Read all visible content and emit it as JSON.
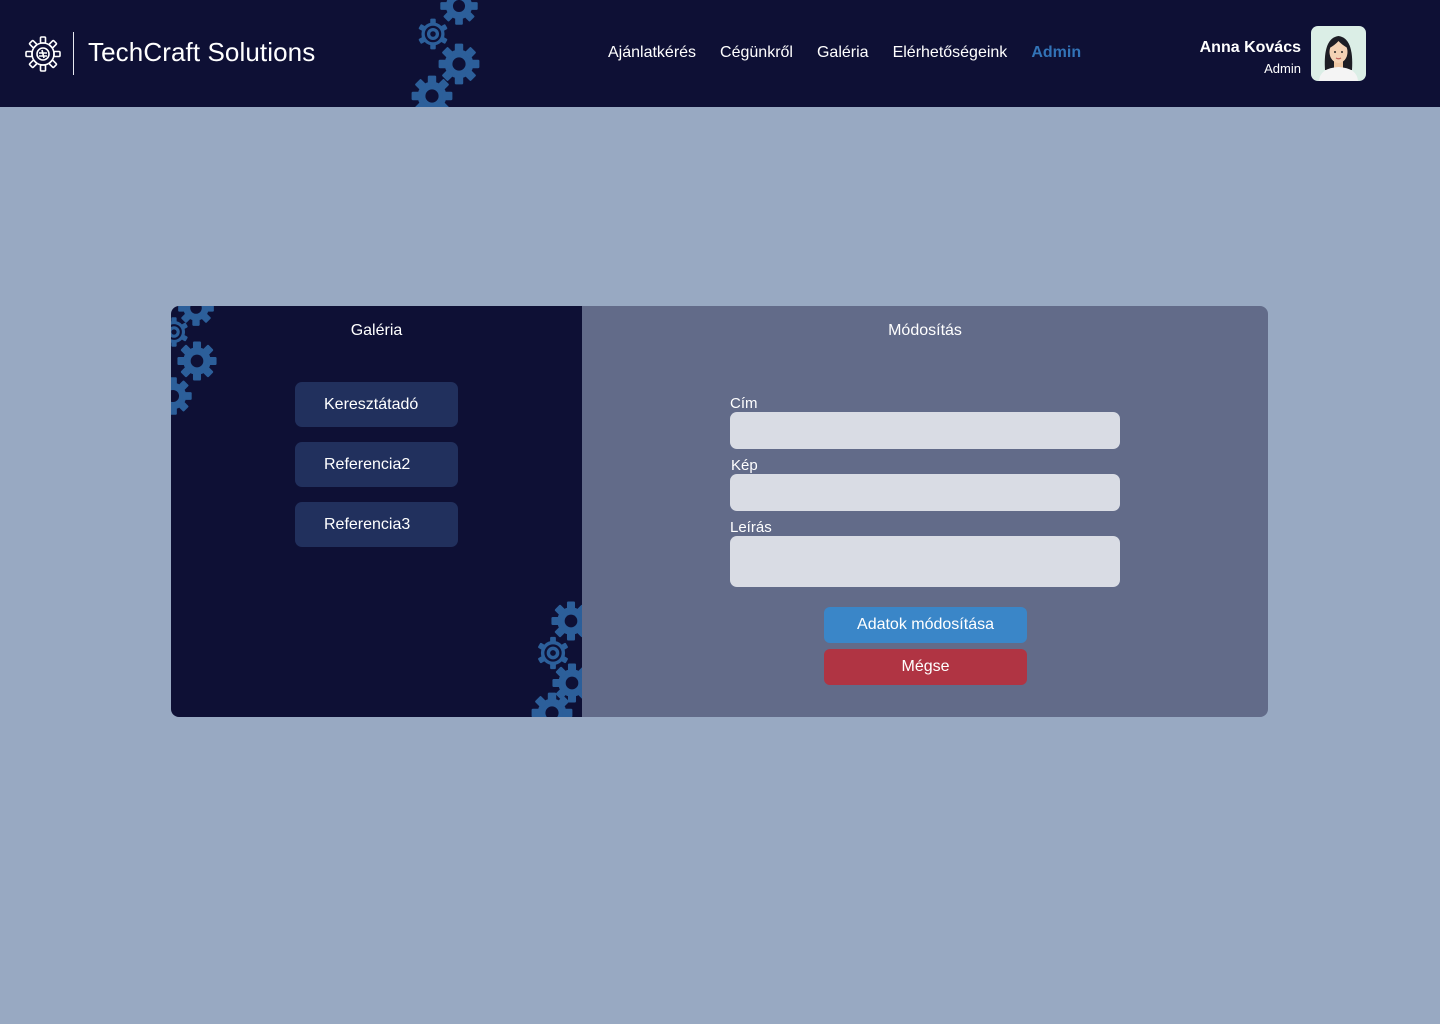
{
  "header": {
    "brand_name": "TechCraft Solutions",
    "logo_icon": "gear-logo-icon",
    "nav": [
      {
        "label": "Ajánlatkérés",
        "active": false
      },
      {
        "label": "Cégünkről",
        "active": false
      },
      {
        "label": "Galéria",
        "active": false
      },
      {
        "label": "Elérhetőségeink",
        "active": false
      },
      {
        "label": "Admin",
        "active": true
      }
    ],
    "user": {
      "name": "Anna Kovács",
      "role": "Admin"
    }
  },
  "gallery": {
    "title": "Galéria",
    "items": [
      "Keresztátadó",
      "Referencia2",
      "Referencia3"
    ]
  },
  "edit": {
    "title": "Módosítás",
    "fields": {
      "title_label": "Cím",
      "title_value": "",
      "image_label": "Kép",
      "image_value": "",
      "description_label": "Leírás",
      "description_value": ""
    },
    "submit_label": "Adatok módosítása",
    "cancel_label": "Mégse"
  },
  "colors": {
    "background": "#98a9c2",
    "header": "#0e1035",
    "accent": "#3273b7",
    "gallery_item": "#21305d",
    "edit_panel": "#626b89",
    "primary_button": "#3a86c8",
    "danger_button": "#b03443"
  }
}
